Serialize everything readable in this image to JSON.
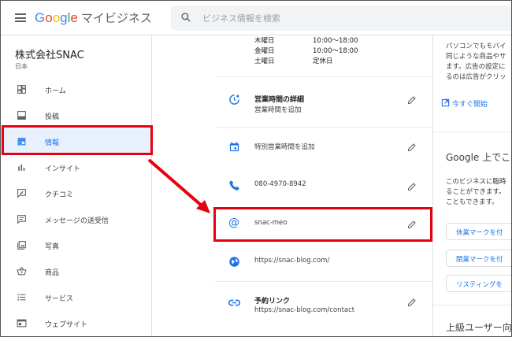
{
  "header": {
    "logo_google": "Google",
    "logo_product": "マイビジネス",
    "search_placeholder": "ビジネス情報を検索"
  },
  "business": {
    "name": "株式会社SNAC",
    "country": "日本"
  },
  "sidebar": {
    "items": [
      {
        "label": "ホーム",
        "icon": "home-dashboard-icon"
      },
      {
        "label": "投稿",
        "icon": "post-icon"
      },
      {
        "label": "情報",
        "icon": "storefront-icon",
        "active": true
      },
      {
        "label": "インサイト",
        "icon": "bar-chart-icon"
      },
      {
        "label": "クチコミ",
        "icon": "review-icon"
      },
      {
        "label": "メッセージの送受信",
        "icon": "message-icon"
      },
      {
        "label": "写真",
        "icon": "photo-icon"
      },
      {
        "label": "商品",
        "icon": "basket-icon"
      },
      {
        "label": "サービス",
        "icon": "list-icon"
      },
      {
        "label": "ウェブサイト",
        "icon": "web-icon"
      }
    ]
  },
  "hours": [
    {
      "day": "木曜日",
      "time": "10:00～18:00"
    },
    {
      "day": "金曜日",
      "time": "10:00～18:00"
    },
    {
      "day": "土曜日",
      "time": "定休日"
    }
  ],
  "fields": {
    "hours_detail": {
      "title": "営業時間の詳細",
      "text": "営業時間を追加"
    },
    "special_hours": {
      "text": "特別営業時間を追加"
    },
    "phone": {
      "text": "080-4970-8942"
    },
    "short_name": {
      "text": "snac-meo"
    },
    "website": {
      "text": "https://snac-blog.com/"
    },
    "booking": {
      "title": "予約リンク",
      "text": "https://snac-blog.com/contact"
    }
  },
  "right_panel": {
    "ad_lines": [
      "パソコンでもモバイ",
      "同じような商品やサ",
      "ます。広告の設定に",
      "るのは広告がクリッ"
    ],
    "start_link": "今すぐ開始",
    "google_heading": "Google 上でこ",
    "closure_lines": [
      "このビジネスに臨時",
      "ることができます。",
      "こともできます。"
    ],
    "buttons": [
      "休業マークを付",
      "閉業マークを付",
      "リスティングを"
    ],
    "advanced_heading": "上級ユーザー向"
  },
  "colors": {
    "accent": "#1a73e8",
    "active_bg": "#e8f0fe",
    "annotation": "#e60012"
  }
}
